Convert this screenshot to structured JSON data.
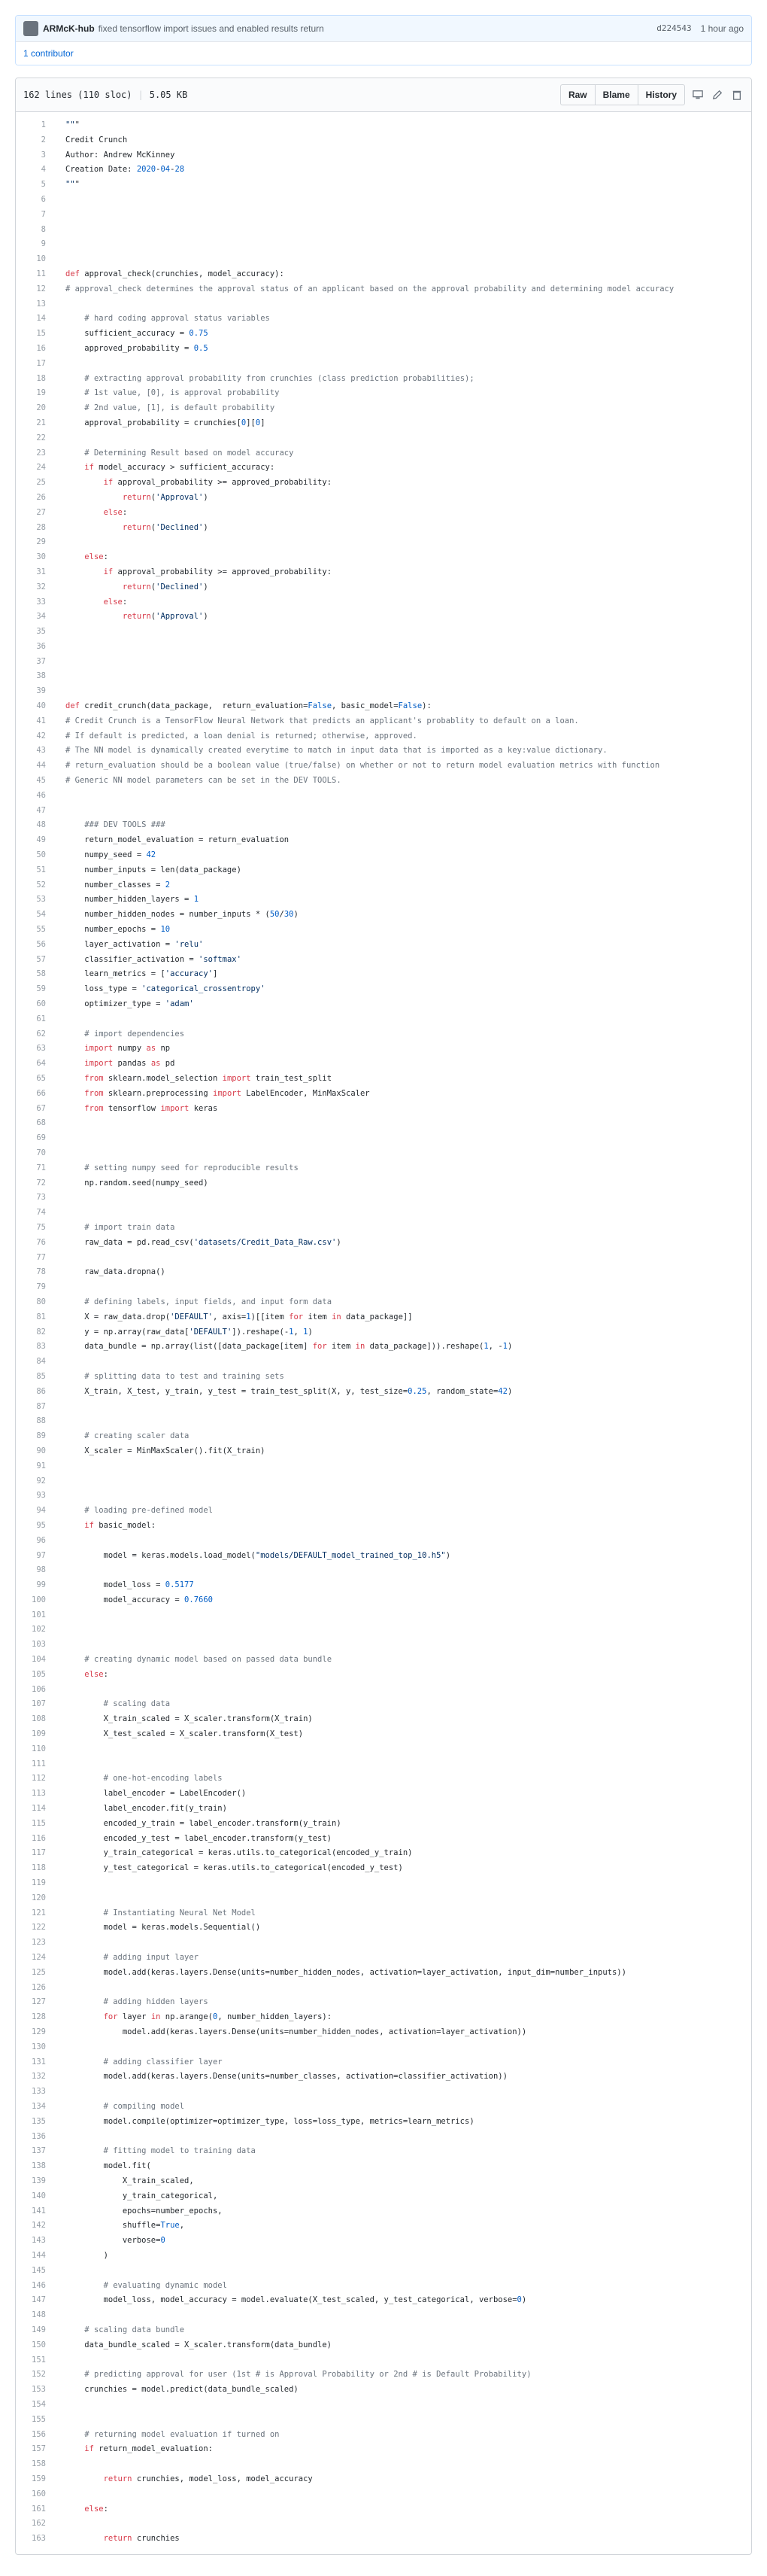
{
  "commit": {
    "author": "ARMcK-hub",
    "message": "fixed tensorflow import issues and enabled results return",
    "sha": "d224543",
    "time": "1 hour ago",
    "contributors": "1 contributor"
  },
  "file": {
    "lines_info": "162 lines (110 sloc)",
    "size": "5.05 KB",
    "buttons": {
      "raw": "Raw",
      "blame": "Blame",
      "history": "History"
    },
    "icons": [
      "desktop-icon",
      "pencil-icon",
      "trash-icon"
    ]
  },
  "code": [
    "\"\"\"",
    "Credit Crunch",
    "Author: Andrew McKinney",
    "Creation Date: 2020-04-28",
    "\"\"\"",
    "",
    "",
    "",
    "",
    "",
    "def approval_check(crunchies, model_accuracy):",
    "# approval_check determines the approval status of an applicant based on the approval probability and determining model accuracy",
    "",
    "    # hard coding approval status variables",
    "    sufficient_accuracy = 0.75",
    "    approved_probability = 0.5",
    "",
    "    # extracting approval probability from crunchies (class prediction probabilities);",
    "    # 1st value, [0], is approval probability",
    "    # 2nd value, [1], is default probability",
    "    approval_probability = crunchies[0][0]",
    "",
    "    # Determining Result based on model accuracy",
    "    if model_accuracy > sufficient_accuracy:",
    "        if approval_probability >= approved_probability:",
    "            return('Approval')",
    "        else:",
    "            return('Declined')",
    "",
    "    else:",
    "        if approval_probability >= approved_probability:",
    "            return('Declined')",
    "        else:",
    "            return('Approval')",
    "",
    "",
    "",
    "",
    "",
    "def credit_crunch(data_package,  return_evaluation=False, basic_model=False):",
    "# Credit Crunch is a TensorFlow Neural Network that predicts an applicant's probablity to default on a loan.",
    "# If default is predicted, a loan denial is returned; otherwise, approved.",
    "# The NN model is dynamically created everytime to match in input data that is imported as a key:value dictionary.",
    "# return_evaluation should be a boolean value (true/false) on whether or not to return model evaluation metrics with function",
    "# Generic NN model parameters can be set in the DEV TOOLS.",
    "",
    "",
    "    ### DEV TOOLS ###",
    "    return_model_evaluation = return_evaluation",
    "    numpy_seed = 42",
    "    number_inputs = len(data_package)",
    "    number_classes = 2",
    "    number_hidden_layers = 1",
    "    number_hidden_nodes = number_inputs * (50/30)",
    "    number_epochs = 10",
    "    layer_activation = 'relu'",
    "    classifier_activation = 'softmax'",
    "    learn_metrics = ['accuracy']",
    "    loss_type = 'categorical_crossentropy'",
    "    optimizer_type = 'adam'",
    "",
    "    # import dependencies",
    "    import numpy as np",
    "    import pandas as pd",
    "    from sklearn.model_selection import train_test_split",
    "    from sklearn.preprocessing import LabelEncoder, MinMaxScaler",
    "    from tensorflow import keras",
    "",
    "",
    "",
    "    # setting numpy seed for reproducible results",
    "    np.random.seed(numpy_seed)",
    "",
    "",
    "    # import train data",
    "    raw_data = pd.read_csv('datasets/Credit_Data_Raw.csv')",
    "",
    "    raw_data.dropna()",
    "",
    "    # defining labels, input fields, and input form data",
    "    X = raw_data.drop('DEFAULT', axis=1)[[item for item in data_package]]",
    "    y = np.array(raw_data['DEFAULT']).reshape(-1, 1)",
    "    data_bundle = np.array(list([data_package[item] for item in data_package])).reshape(1, -1)",
    "",
    "    # splitting data to test and training sets",
    "    X_train, X_test, y_train, y_test = train_test_split(X, y, test_size=0.25, random_state=42)",
    "",
    "",
    "    # creating scaler data",
    "    X_scaler = MinMaxScaler().fit(X_train)",
    "",
    "",
    "",
    "    # loading pre-defined model",
    "    if basic_model:",
    "",
    "        model = keras.models.load_model(\"models/DEFAULT_model_trained_top_10.h5\")",
    "",
    "        model_loss = 0.5177",
    "        model_accuracy = 0.7660",
    "",
    "",
    "",
    "    # creating dynamic model based on passed data bundle",
    "    else:",
    "",
    "        # scaling data",
    "        X_train_scaled = X_scaler.transform(X_train)",
    "        X_test_scaled = X_scaler.transform(X_test)",
    "",
    "",
    "        # one-hot-encoding labels",
    "        label_encoder = LabelEncoder()",
    "        label_encoder.fit(y_train)",
    "        encoded_y_train = label_encoder.transform(y_train)",
    "        encoded_y_test = label_encoder.transform(y_test)",
    "        y_train_categorical = keras.utils.to_categorical(encoded_y_train)",
    "        y_test_categorical = keras.utils.to_categorical(encoded_y_test)",
    "",
    "",
    "        # Instantiating Neural Net Model",
    "        model = keras.models.Sequential()",
    "",
    "        # adding input layer",
    "        model.add(keras.layers.Dense(units=number_hidden_nodes, activation=layer_activation, input_dim=number_inputs))",
    "",
    "        # adding hidden layers",
    "        for layer in np.arange(0, number_hidden_layers):",
    "            model.add(keras.layers.Dense(units=number_hidden_nodes, activation=layer_activation))",
    "",
    "        # adding classifier layer",
    "        model.add(keras.layers.Dense(units=number_classes, activation=classifier_activation))",
    "",
    "        # compiling model",
    "        model.compile(optimizer=optimizer_type, loss=loss_type, metrics=learn_metrics)",
    "",
    "        # fitting model to training data",
    "        model.fit(",
    "            X_train_scaled,",
    "            y_train_categorical,",
    "            epochs=number_epochs,",
    "            shuffle=True,",
    "            verbose=0",
    "        )",
    "",
    "        # evaluating dynamic model",
    "        model_loss, model_accuracy = model.evaluate(X_test_scaled, y_test_categorical, verbose=0)",
    "",
    "    # scaling data bundle",
    "    data_bundle_scaled = X_scaler.transform(data_bundle)",
    "",
    "    # predicting approval for user (1st # is Approval Probability or 2nd # is Default Probability)",
    "    crunchies = model.predict(data_bundle_scaled)",
    "",
    "",
    "    # returning model evaluation if turned on",
    "    if return_model_evaluation:",
    "",
    "        return crunchies, model_loss, model_accuracy",
    "",
    "    else:",
    "",
    "        return crunchies"
  ]
}
